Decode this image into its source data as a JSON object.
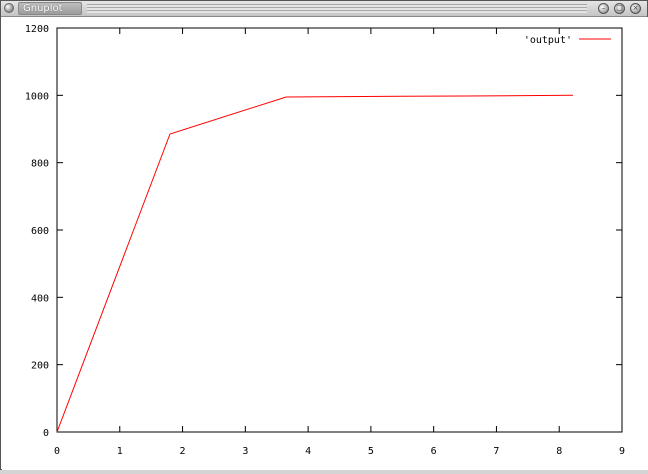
{
  "window": {
    "title": "Gnuplot",
    "title_icon": "window-menu-icon",
    "buttons": [
      {
        "name": "minimize-button",
        "icon": "minimize-icon",
        "glyph": "–"
      },
      {
        "name": "maximize-button",
        "icon": "maximize-icon",
        "glyph": "□"
      },
      {
        "name": "close-button",
        "icon": "close-icon",
        "glyph": "×"
      }
    ]
  },
  "chart_data": {
    "type": "line",
    "title": "",
    "xlabel": "",
    "ylabel": "",
    "xlim": [
      0,
      9
    ],
    "ylim": [
      0,
      1200
    ],
    "xticks": [
      0,
      1,
      2,
      3,
      4,
      5,
      6,
      7,
      8,
      9
    ],
    "yticks": [
      0,
      200,
      400,
      600,
      800,
      1000,
      1200
    ],
    "grid": false,
    "legend": "top-right",
    "series": [
      {
        "name": "'output'",
        "color": "#ff0000",
        "x": [
          0,
          1.8,
          3.65,
          5.5,
          6.5,
          8.22
        ],
        "y": [
          0,
          885,
          995,
          997,
          998,
          1000
        ]
      }
    ]
  }
}
